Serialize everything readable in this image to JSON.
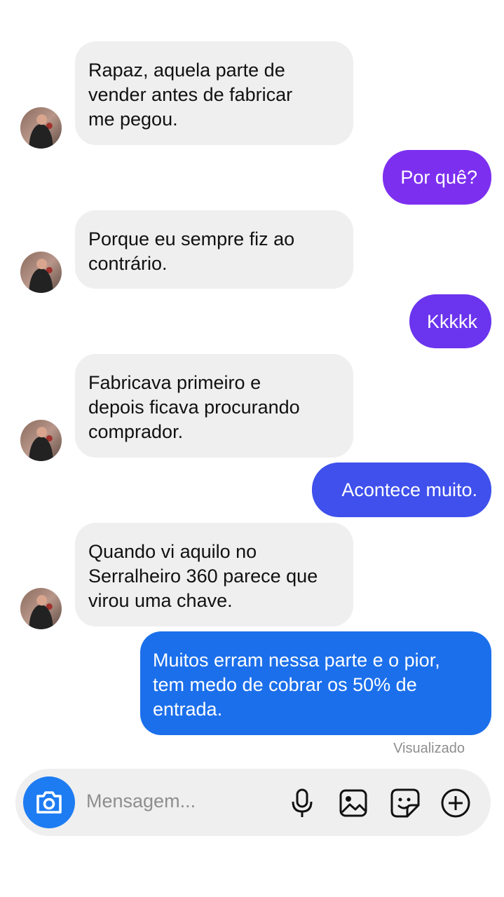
{
  "messages": [
    {
      "direction": "incoming",
      "text": "Rapaz, aquela parte de\nvender antes de fabricar\nme pegou."
    },
    {
      "direction": "outgoing",
      "text": "Por quê?",
      "color": "#7d2ff0"
    },
    {
      "direction": "incoming",
      "text": "Porque eu sempre fiz ao\ncontrário."
    },
    {
      "direction": "outgoing",
      "text": "Kkkkk",
      "color": "#6b34ee"
    },
    {
      "direction": "incoming",
      "text": "Fabricava primeiro e\ndepois ficava procurando\ncomprador."
    },
    {
      "direction": "outgoing",
      "text": "Acontece muito.",
      "color": "#3f50ec"
    },
    {
      "direction": "incoming",
      "text": "Quando vi aquilo no\nSerralheiro 360 parece que\nvirou uma chave."
    },
    {
      "direction": "outgoing",
      "text": "Muitos erram nessa parte e o pior,\ntem medo de cobrar os 50% de\nentrada.",
      "color": "#1b6feb"
    }
  ],
  "status": {
    "seen_label": "Visualizado"
  },
  "composer": {
    "placeholder": "Mensagem...",
    "camera_color": "#1d7cf2",
    "icons": [
      "camera-icon",
      "microphone-icon",
      "gallery-icon",
      "sticker-icon",
      "plus-icon"
    ]
  }
}
